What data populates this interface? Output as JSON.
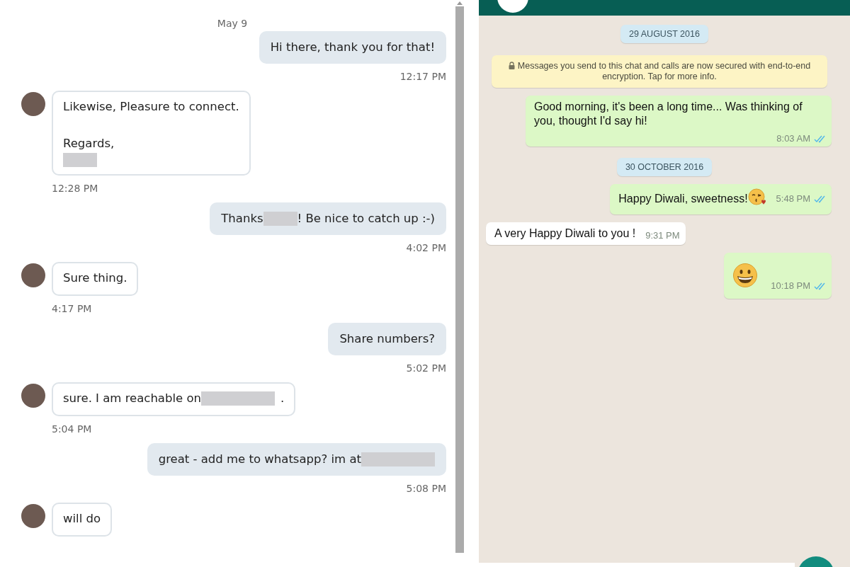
{
  "linkedin_chat": {
    "date": "May 9",
    "messages": [
      {
        "kind": "outgoing",
        "paragraphs": [
          {
            "lines": [
              {
                "parts": [
                  {
                    "kind": "text",
                    "text": "Hi there, thank you for that!"
                  }
                ]
              }
            ]
          }
        ],
        "time": "12:17 PM"
      },
      {
        "kind": "incoming",
        "paragraphs": [
          {
            "lines": [
              {
                "parts": [
                  {
                    "kind": "text",
                    "text": "Likewise, Pleasure to connect."
                  }
                ]
              }
            ]
          },
          {
            "lines": [
              {
                "parts": [
                  {
                    "kind": "text",
                    "text": "Regards,"
                  }
                ]
              },
              {
                "parts": [
                  {
                    "kind": "redacted",
                    "wide": false
                  }
                ]
              }
            ]
          }
        ],
        "time": "12:28 PM"
      },
      {
        "kind": "outgoing",
        "paragraphs": [
          {
            "lines": [
              {
                "parts": [
                  {
                    "kind": "text",
                    "text": "Thanks"
                  },
                  {
                    "kind": "redacted",
                    "wide": false
                  },
                  {
                    "kind": "text",
                    "text": "! Be nice to catch up :-)"
                  }
                ]
              }
            ]
          }
        ],
        "time": "4:02 PM"
      },
      {
        "kind": "incoming",
        "paragraphs": [
          {
            "lines": [
              {
                "parts": [
                  {
                    "kind": "text",
                    "text": "Sure thing."
                  }
                ]
              }
            ]
          }
        ],
        "time": "4:17 PM"
      },
      {
        "kind": "outgoing",
        "paragraphs": [
          {
            "lines": [
              {
                "parts": [
                  {
                    "kind": "text",
                    "text": "Share numbers?"
                  }
                ]
              }
            ]
          }
        ],
        "time": "5:02 PM"
      },
      {
        "kind": "incoming",
        "paragraphs": [
          {
            "lines": [
              {
                "parts": [
                  {
                    "kind": "text",
                    "text": "sure. I am reachable on"
                  },
                  {
                    "kind": "redacted",
                    "wide": true
                  },
                  {
                    "kind": "text",
                    "text": "."
                  }
                ]
              }
            ]
          }
        ],
        "time": "5:04 PM"
      },
      {
        "kind": "outgoing",
        "paragraphs": [
          {
            "lines": [
              {
                "parts": [
                  {
                    "kind": "text",
                    "text": "great - add me to whatsapp? im at"
                  },
                  {
                    "kind": "redacted",
                    "wide": true
                  }
                ]
              }
            ]
          }
        ],
        "time": "5:08 PM"
      },
      {
        "kind": "incoming",
        "paragraphs": [
          {
            "lines": [
              {
                "parts": [
                  {
                    "kind": "text",
                    "text": "will do"
                  }
                ]
              }
            ]
          }
        ]
      }
    ]
  },
  "whatsapp_chat": {
    "items": [
      {
        "kind": "date",
        "text": "29 AUGUST 2016"
      },
      {
        "kind": "notice",
        "text": "Messages you send to this chat and calls are now secured with end-to-end encryption. Tap for more info."
      },
      {
        "kind": "outgoing",
        "parts": [
          {
            "kind": "text",
            "text": "Good morning, it's been a long time... Was thinking of you, thought I'd say hi!"
          }
        ],
        "time": "8:03 AM",
        "read": true
      },
      {
        "kind": "date",
        "text": "30 OCTOBER 2016"
      },
      {
        "kind": "outgoing",
        "parts": [
          {
            "kind": "text",
            "text": "Happy Diwali, sweetness!"
          },
          {
            "kind": "kiss"
          }
        ],
        "time": "5:48 PM",
        "read": true
      },
      {
        "kind": "incoming",
        "parts": [
          {
            "kind": "text",
            "text": "A very Happy Diwali to you !"
          }
        ],
        "time": "9:31 PM"
      },
      {
        "kind": "outgoing",
        "parts": [
          {
            "kind": "grin"
          }
        ],
        "time": "10:18 PM",
        "read": true
      }
    ]
  }
}
